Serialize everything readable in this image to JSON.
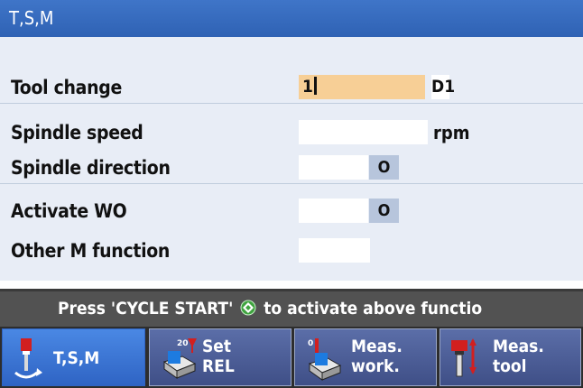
{
  "window": {
    "title": "T,S,M"
  },
  "form": {
    "tool_change": {
      "label": "Tool change",
      "value": "1",
      "edge": "D1"
    },
    "spindle_speed": {
      "label": "Spindle speed",
      "value": "",
      "unit": "rpm"
    },
    "spindle_direction": {
      "label": "Spindle direction",
      "value": "",
      "toggle_symbol": "O"
    },
    "activate_wo": {
      "label": "Activate WO",
      "value": "",
      "toggle_symbol": "O"
    },
    "other_m_function": {
      "label": "Other M function",
      "value": ""
    }
  },
  "status": {
    "prefix": "Press 'CYCLE START'",
    "suffix": "to activate above functio"
  },
  "softkeys": [
    {
      "label": "T,S,M",
      "icon": "tool-spindle-icon"
    },
    {
      "label_line1": "Set",
      "label_line2": "REL",
      "icon": "set-rel-icon"
    },
    {
      "label_line1": "Meas.",
      "label_line2": "work.",
      "icon": "measure-workpiece-icon"
    },
    {
      "label_line1": "Meas.",
      "label_line2": "tool",
      "icon": "measure-tool-icon"
    }
  ],
  "colors": {
    "title_bg": "#3a6fc4",
    "active_field": "#f7cf96",
    "softkey_active": "#3c78d8"
  }
}
